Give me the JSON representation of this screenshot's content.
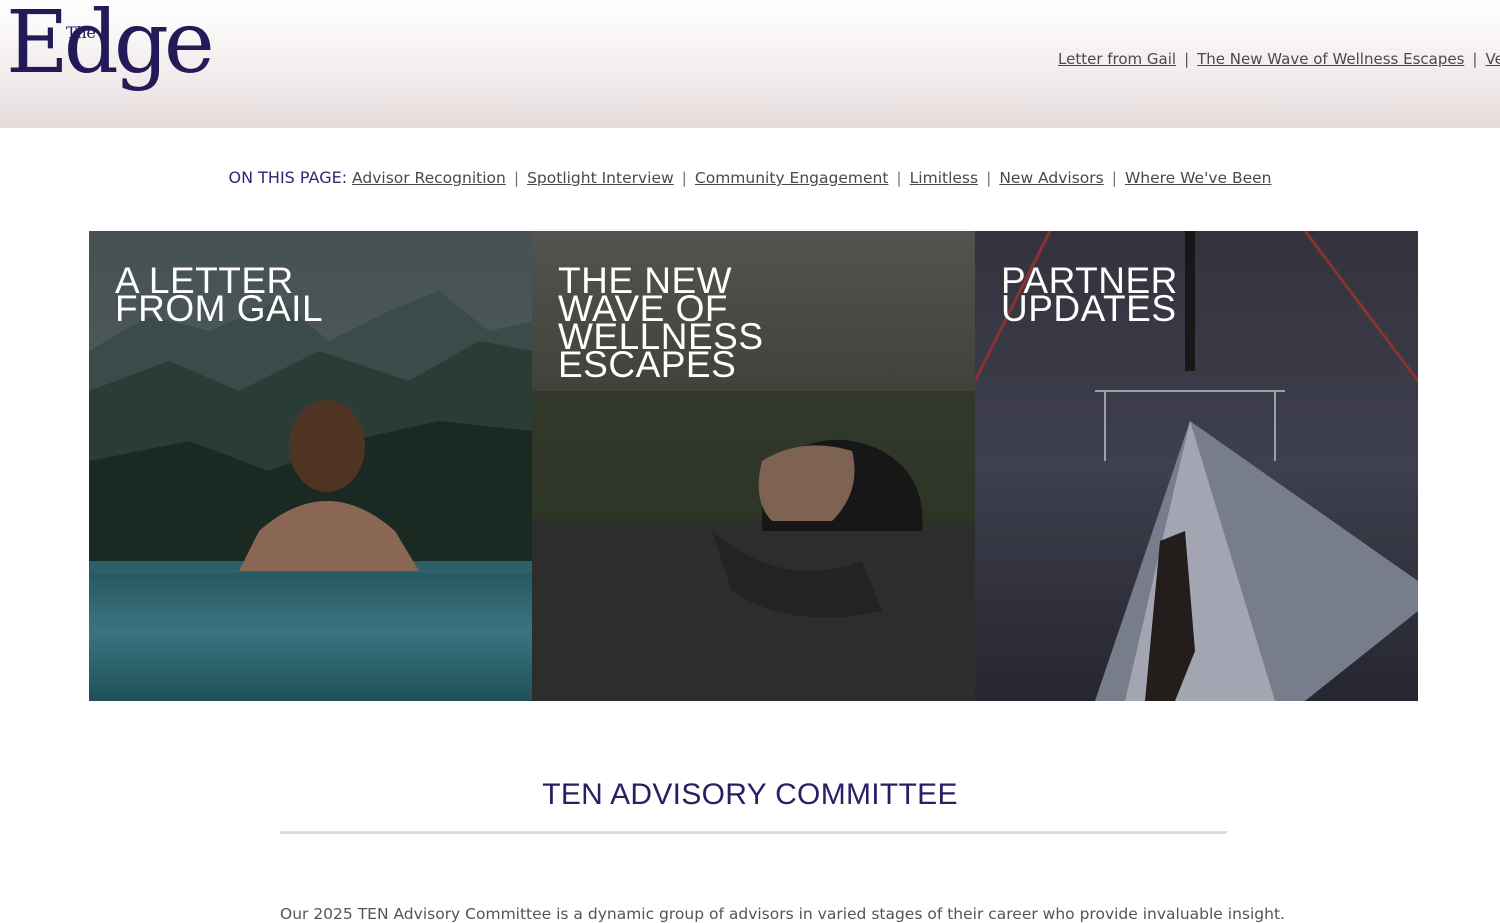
{
  "header": {
    "logo_small": "The",
    "logo_large": "Edge",
    "nav": [
      {
        "label": "Letter from Gail"
      },
      {
        "label": "The New Wave of Wellness Escapes"
      },
      {
        "label": "Ver"
      }
    ]
  },
  "on_this_page": {
    "label": "ON THIS PAGE:",
    "links": [
      {
        "label": "Advisor Recognition"
      },
      {
        "label": "Spotlight Interview"
      },
      {
        "label": "Community Engagement"
      },
      {
        "label": "Limitless"
      },
      {
        "label": "New Advisors"
      },
      {
        "label": "Where We've Been"
      }
    ]
  },
  "tiles": [
    {
      "title": "A LETTER\nFROM GAIL"
    },
    {
      "title": "THE NEW\nWAVE OF\nWELLNESS\nESCAPES"
    },
    {
      "title": "PARTNER\nUPDATES"
    }
  ],
  "section": {
    "title": "TEN ADVISORY COMMITTEE",
    "intro": "Our 2025 TEN Advisory Committee is a dynamic group of advisors in varied stages of their career who provide invaluable insight."
  },
  "colors": {
    "brand": "#241a57",
    "heading": "#2a1f62",
    "link": "#4a4a4a",
    "rule": "#e8d8de"
  }
}
